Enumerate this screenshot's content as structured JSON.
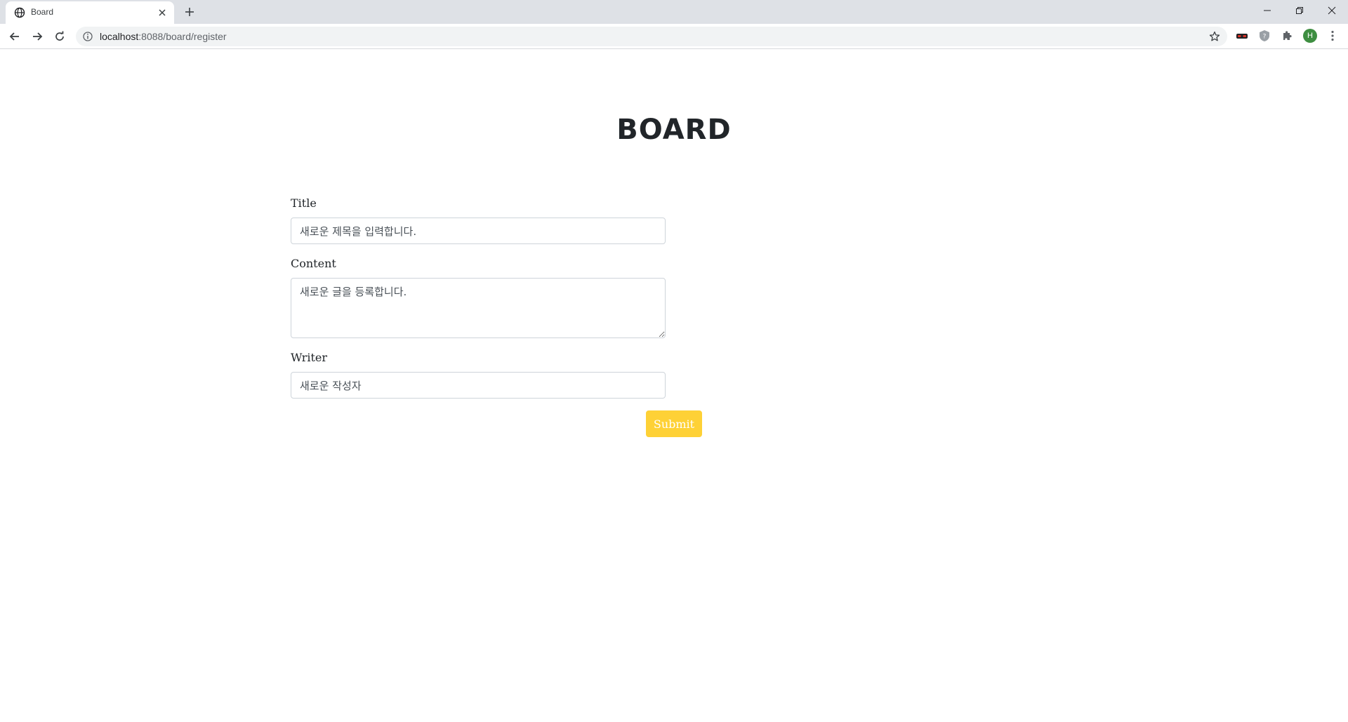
{
  "browser": {
    "tab_title": "Board",
    "url_host": "localhost",
    "url_path": ":8088/board/register",
    "avatar_letter": "H"
  },
  "page": {
    "title": "BOARD"
  },
  "form": {
    "title_label": "Title",
    "title_value": "새로운 제목을 입력합니다.",
    "content_label": "Content",
    "content_value": "새로운 글을 등록합니다.",
    "writer_label": "Writer",
    "writer_value": "새로운 작성자",
    "submit_label": "Submit"
  },
  "colors": {
    "accent": "#fed136",
    "text": "#212529"
  }
}
